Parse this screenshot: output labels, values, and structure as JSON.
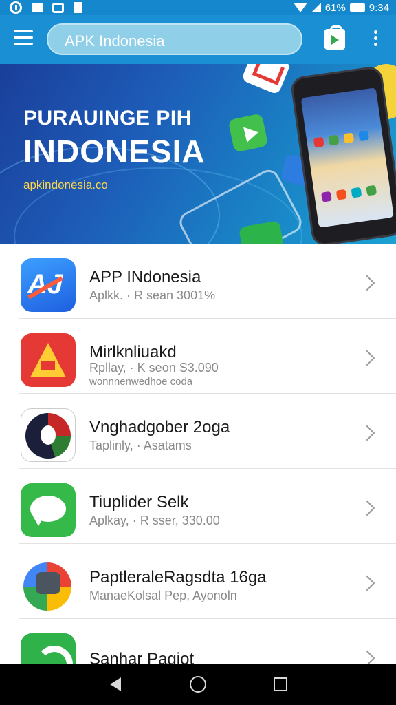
{
  "status_bar": {
    "battery": "61%",
    "time": "9:34",
    "icons": [
      "clock-icon",
      "grid-icon",
      "square-icon",
      "doc-icon",
      "wifi-icon",
      "signal-icon",
      "battery-icon"
    ]
  },
  "app_bar": {
    "search_text": "APK Indonesia",
    "icons": [
      "menu-icon",
      "play-store-icon",
      "more-vert-icon"
    ]
  },
  "banner": {
    "title_line1": "PURAUINGE PIH",
    "title_line2": "INDONESIA",
    "url": "apkindonesia.co"
  },
  "apps": [
    {
      "title": "APP INdonesia",
      "subtitle": "Aplkk. · R sean 3001%",
      "subtitle2": ""
    },
    {
      "title": "Mirlknliuakd",
      "subtitle": "Rpllay, · K seon S3.090",
      "subtitle2": "wonnnenwedhoe coda"
    },
    {
      "title": "Vnghadgober 2oga",
      "subtitle": "Taplinly, · Asatams",
      "subtitle2": ""
    },
    {
      "title": "Tiuplider Selk",
      "subtitle": "Aplkay, · R sser, 330.00",
      "subtitle2": ""
    },
    {
      "title": "PaptleraleRagsdta 16ga",
      "subtitle": "ManaeKolsal Pep, Ayonoln",
      "subtitle2": ""
    },
    {
      "title": "Sanhar Pagiot",
      "subtitle": "",
      "subtitle2": ""
    }
  ],
  "colors": {
    "app_bar": "#1a8fd4",
    "status_bar": "#1587cc",
    "banner_url": "#ffd54a"
  },
  "nav_bar": {
    "icons": [
      "back-icon",
      "home-icon",
      "recents-icon"
    ]
  }
}
